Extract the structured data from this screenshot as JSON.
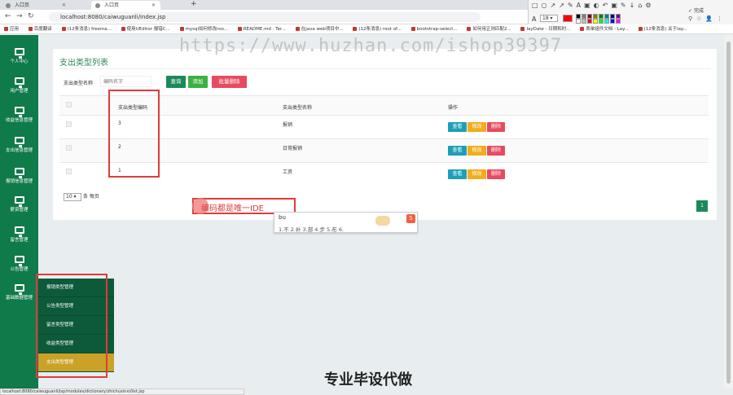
{
  "browser": {
    "tabs": [
      "入口页",
      "入口页"
    ],
    "url": "localhost:8080/caiwuguanli/index.jsp",
    "bookmarks": [
      "应用",
      "百度翻译",
      "(12条消息) freema...",
      "使用UEditor 报错C...",
      "mysql如何修改roo...",
      "README.md · Ter...",
      "在java web项目中...",
      "(12条消息) root of...",
      "bootstrap-select...",
      "如何用正则匹配2...",
      "layDate - 日期和时...",
      "表单组件文档 - Lay...",
      "(12条消息) 关于lay..."
    ],
    "annotator_font_size": "18",
    "colors": [
      "#000000",
      "#808080",
      "#800000",
      "#808000",
      "#008000",
      "#008080",
      "#000080",
      "#800080",
      "#ffffff",
      "#c0c0c0",
      "#ff0000",
      "#ffff00",
      "#00ff00",
      "#00ffff",
      "#0000ff",
      "#ff00ff"
    ],
    "status_url": "localhost:8080/caiwuguanli/jsp/modules/dictionary/zhichuxinxi/list.jsp",
    "annotator_done": "完成"
  },
  "sidebar": {
    "items": [
      "个人中心",
      "用户管理",
      "收益信息管理",
      "支出信息管理",
      "报销信息管理",
      "薪资管理",
      "留言管理",
      "公告管理",
      "基础数据管理"
    ]
  },
  "submenu": {
    "items": [
      "报销类型管理",
      "公告类型管理",
      "留言类型管理",
      "收益类型管理",
      "支出类型管理"
    ],
    "active_index": 4
  },
  "main": {
    "title": "支出类型列表",
    "search_label": "支出类型名称",
    "search_placeholder": "编码名字",
    "buttons": {
      "query": "查询",
      "add": "添加",
      "batch_delete": "批量删除"
    },
    "columns": [
      "支出类型编码",
      "支出类型名称",
      "操作"
    ],
    "rows": [
      {
        "code": "3",
        "name": "报销"
      },
      {
        "code": "2",
        "name": "日常报销"
      },
      {
        "code": "1",
        "name": "工资"
      }
    ],
    "actions": {
      "view": "查看",
      "edit": "修改",
      "delete": "删除"
    },
    "page_size": "10",
    "page_size_suffix": "条 每页",
    "current_page": "1"
  },
  "annotation": {
    "text": "编码都是唯一IDE"
  },
  "ime": {
    "input": "bu",
    "candidates": "1.不  2.补  3.部  4.步  5.布  6."
  },
  "watermark": "https://www.huzhan.com/ishop39397",
  "caption": "专业毕设代做"
}
